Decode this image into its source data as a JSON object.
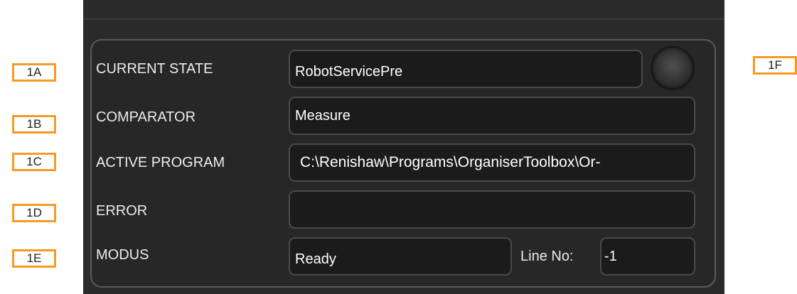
{
  "callouts": {
    "a": "1A",
    "b": "1B",
    "c": "1C",
    "d": "1D",
    "e": "1E",
    "f": "1F"
  },
  "status_panel": {
    "current_state": {
      "label": "CURRENT STATE",
      "value": "RobotServicePre"
    },
    "comparator": {
      "label": "COMPARATOR",
      "value": "Measure"
    },
    "active_program": {
      "label": "ACTIVE PROGRAM",
      "value": "C:\\Renishaw\\Programs\\OrganiserToolbox\\Or-"
    },
    "error": {
      "label": "ERROR",
      "value": ""
    },
    "modus": {
      "label": "MODUS",
      "value": "Ready"
    },
    "line_no": {
      "label": "Line No:",
      "value": "-1"
    },
    "indicator": {
      "icon": "status-led-icon",
      "state": "off"
    }
  },
  "colors": {
    "callout_border": "#f59a23",
    "panel_background": "#2a2a2a",
    "field_background": "#1b1b1b",
    "field_border": "#4a4a4a",
    "text": "#ececec"
  }
}
